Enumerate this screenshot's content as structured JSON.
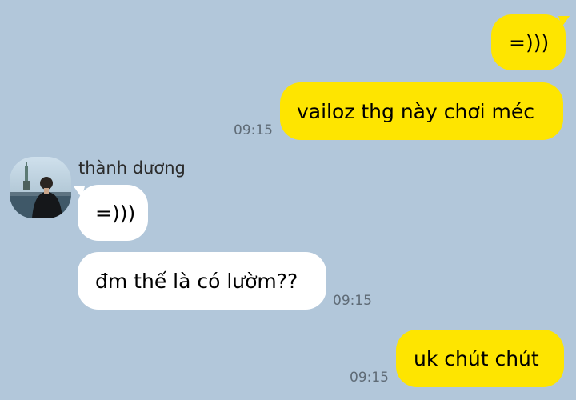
{
  "colors": {
    "background": "#b2c7da",
    "outgoing_bubble": "#fee500",
    "incoming_bubble": "#ffffff",
    "timestamp": "#5f6b76"
  },
  "contact": {
    "name": "thành dương",
    "avatar_icon": "profile-photo-avatar"
  },
  "messages": [
    {
      "direction": "outgoing",
      "text": "=)))",
      "time": ""
    },
    {
      "direction": "outgoing",
      "text": "vailoz thg này chơi méc",
      "time": "09:15"
    },
    {
      "direction": "incoming",
      "text": "=)))",
      "time": ""
    },
    {
      "direction": "incoming",
      "text": "đm thế là có lườm??",
      "time": "09:15"
    },
    {
      "direction": "outgoing",
      "text": "uk chút chút",
      "time": "09:15"
    }
  ]
}
